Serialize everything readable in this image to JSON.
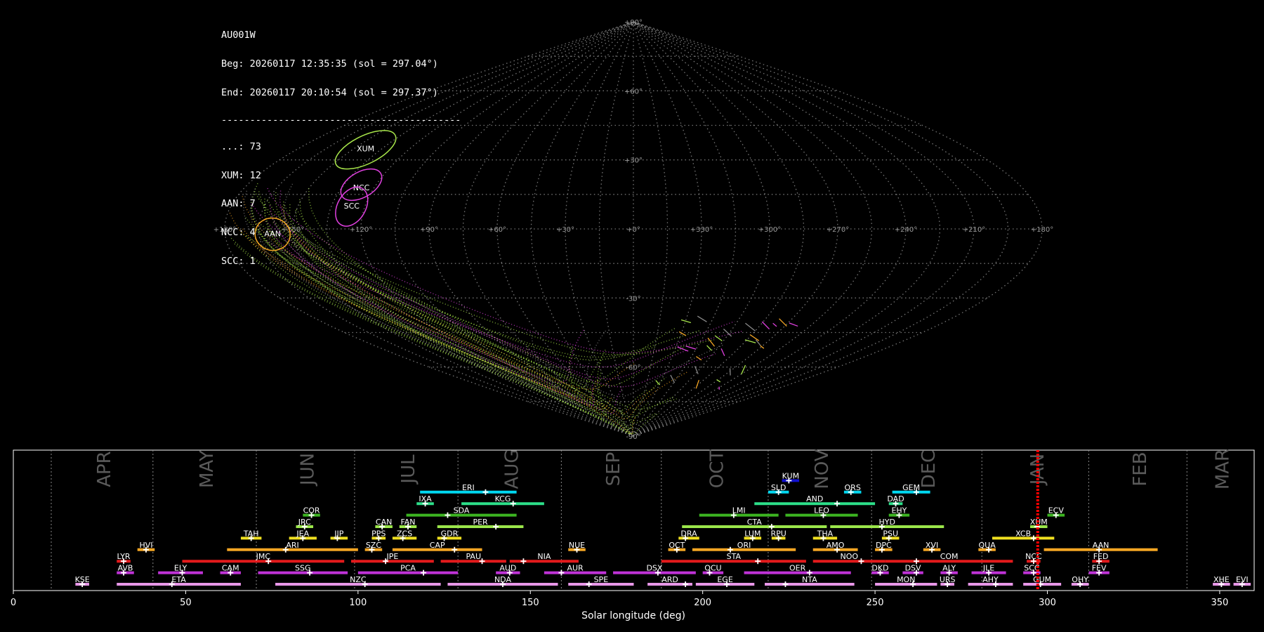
{
  "info": {
    "station": "AU001W",
    "begin": "Beg: 20260117 12:35:35 (sol = 297.04°)",
    "end": "End: 20260117 20:10:54 (sol = 297.37°)",
    "separator": "------------------------------------------",
    "counts": [
      "...: 73",
      "XUM: 12",
      "AAN: 7",
      "NCC: 4",
      "SCC: 1"
    ]
  },
  "colors": {
    "background": "#000000",
    "grid": "#8a8a8a",
    "yellow_green": "#a8e64a",
    "magenta": "#e040e0",
    "orange": "#f5a623",
    "red": "#e31a1c",
    "green": "#3cb521",
    "cyan": "#00d8f0",
    "teal_green": "#2de08a",
    "light_green": "#9be64a",
    "yellow": "#f0e020",
    "purple": "#c033d8",
    "pink": "#e896e8",
    "blue": "#1010d0",
    "sol_marker": "#ff0000"
  },
  "sky_map": {
    "projection": "sinusoidal",
    "lat_labels": [
      "+90°",
      "+60°",
      "+30°",
      "-30°",
      "-60°",
      "-90°"
    ],
    "lon_labels": [
      "+180°",
      "+150°",
      "+120°",
      "+90°",
      "+60°",
      "+30°",
      "+0°",
      "+330°",
      "+300°",
      "+270°",
      "+240°",
      "+210°",
      "+180°"
    ],
    "showers": [
      {
        "code": "XUM",
        "lon": 144,
        "lat": 35,
        "color": "yellow_green"
      },
      {
        "code": "NCC",
        "lon": 126,
        "lat": 18,
        "color": "magenta"
      },
      {
        "code": "SCC",
        "lon": 126,
        "lat": 10,
        "color": "magenta"
      },
      {
        "code": "AAN",
        "lon": 159,
        "lat": -2,
        "color": "orange"
      }
    ]
  },
  "chart_data": {
    "type": "gantt",
    "title": "",
    "xlabel": "Solar longitude (deg)",
    "xlim": [
      0,
      360
    ],
    "xticks": [
      0,
      50,
      100,
      150,
      200,
      250,
      300,
      350
    ],
    "current_sol": [
      297.04,
      297.37
    ],
    "months": [
      {
        "name": "APR",
        "start": 11
      },
      {
        "name": "MAY",
        "start": 40.5
      },
      {
        "name": "JUN",
        "start": 70.5
      },
      {
        "name": "JUL",
        "start": 99
      },
      {
        "name": "AUG",
        "start": 129
      },
      {
        "name": "SEP",
        "start": 159
      },
      {
        "name": "OCT",
        "start": 188
      },
      {
        "name": "NOV",
        "start": 219
      },
      {
        "name": "DEC",
        "start": 249
      },
      {
        "name": "JAN",
        "start": 281
      },
      {
        "name": "FEB",
        "start": 312
      },
      {
        "name": "MAR",
        "start": 340.5
      }
    ],
    "showers": [
      {
        "code": "KUM",
        "start": 223,
        "end": 228,
        "peak": 225,
        "row": 10,
        "color": "blue"
      },
      {
        "code": "ERI",
        "start": 118,
        "end": 146,
        "peak": 137,
        "row": 9,
        "color": "cyan"
      },
      {
        "code": "SLD",
        "start": 219,
        "end": 225,
        "peak": 222,
        "row": 9,
        "color": "cyan"
      },
      {
        "code": "ORS",
        "start": 241,
        "end": 246,
        "peak": 243,
        "row": 9,
        "color": "cyan"
      },
      {
        "code": "GEM",
        "start": 255,
        "end": 266,
        "peak": 262,
        "row": 9,
        "color": "cyan"
      },
      {
        "code": "IXA",
        "start": 117,
        "end": 122,
        "peak": 119.5,
        "row": 8,
        "color": "teal_green"
      },
      {
        "code": "KCG",
        "start": 130,
        "end": 154,
        "peak": 145,
        "row": 8,
        "color": "teal_green"
      },
      {
        "code": "AND",
        "start": 215,
        "end": 250,
        "peak": 239,
        "row": 8,
        "color": "teal_green"
      },
      {
        "code": "DAD",
        "start": 254,
        "end": 258,
        "peak": 256,
        "row": 8,
        "color": "teal_green"
      },
      {
        "code": "COR",
        "start": 84,
        "end": 89,
        "peak": 86.5,
        "row": 7,
        "color": "green"
      },
      {
        "code": "SDA",
        "start": 114,
        "end": 146,
        "peak": 126,
        "row": 7,
        "color": "green"
      },
      {
        "code": "LMI",
        "start": 199,
        "end": 222,
        "peak": 209,
        "row": 7,
        "color": "green"
      },
      {
        "code": "LEO",
        "start": 224,
        "end": 245,
        "peak": 235,
        "row": 7,
        "color": "green"
      },
      {
        "code": "EHY",
        "start": 254,
        "end": 260,
        "peak": 257,
        "row": 7,
        "color": "green"
      },
      {
        "code": "ECV",
        "start": 300,
        "end": 305,
        "peak": 302.5,
        "row": 7,
        "color": "green"
      },
      {
        "code": "JRC",
        "start": 82,
        "end": 87,
        "peak": 84.5,
        "row": 6,
        "color": "light_green"
      },
      {
        "code": "CAN",
        "start": 105,
        "end": 110,
        "peak": 107,
        "row": 6,
        "color": "light_green"
      },
      {
        "code": "FAN",
        "start": 112,
        "end": 117,
        "peak": 114.5,
        "row": 6,
        "color": "light_green"
      },
      {
        "code": "PER",
        "start": 123,
        "end": 148,
        "peak": 140,
        "row": 6,
        "color": "light_green"
      },
      {
        "code": "CTA",
        "start": 194,
        "end": 236,
        "peak": 220,
        "row": 6,
        "color": "light_green"
      },
      {
        "code": "HYD",
        "start": 237,
        "end": 270,
        "peak": 252,
        "row": 6,
        "color": "light_green"
      },
      {
        "code": "XUM",
        "start": 295,
        "end": 300,
        "peak": 297,
        "row": 6,
        "color": "light_green"
      },
      {
        "code": "TAH",
        "start": 66,
        "end": 72,
        "peak": 69,
        "row": 5,
        "color": "yellow"
      },
      {
        "code": "JEA",
        "start": 80,
        "end": 88,
        "peak": 84,
        "row": 5,
        "color": "yellow"
      },
      {
        "code": "JIP",
        "start": 92,
        "end": 97,
        "peak": 94,
        "row": 5,
        "color": "yellow"
      },
      {
        "code": "PPS",
        "start": 104,
        "end": 108,
        "peak": 106,
        "row": 5,
        "color": "yellow"
      },
      {
        "code": "ZCS",
        "start": 110,
        "end": 117,
        "peak": 113,
        "row": 5,
        "color": "yellow"
      },
      {
        "code": "GDR",
        "start": 123,
        "end": 130,
        "peak": 125,
        "row": 5,
        "color": "yellow"
      },
      {
        "code": "DRA",
        "start": 193,
        "end": 199,
        "peak": 195,
        "row": 5,
        "color": "yellow"
      },
      {
        "code": "LUM",
        "start": 212,
        "end": 217,
        "peak": 214.5,
        "row": 5,
        "color": "yellow"
      },
      {
        "code": "RPU",
        "start": 220,
        "end": 224,
        "peak": 222,
        "row": 5,
        "color": "yellow"
      },
      {
        "code": "THA",
        "start": 232,
        "end": 239,
        "peak": 235,
        "row": 5,
        "color": "yellow"
      },
      {
        "code": "PSU",
        "start": 252,
        "end": 257,
        "peak": 254,
        "row": 5,
        "color": "yellow"
      },
      {
        "code": "XCB",
        "start": 284,
        "end": 302,
        "peak": 296,
        "row": 5,
        "color": "yellow"
      },
      {
        "code": "HVI",
        "start": 36,
        "end": 41,
        "peak": 38.5,
        "row": 4,
        "color": "orange"
      },
      {
        "code": "ARI",
        "start": 62,
        "end": 100,
        "peak": 79,
        "row": 4,
        "color": "orange"
      },
      {
        "code": "SZC",
        "start": 102,
        "end": 107,
        "peak": 104,
        "row": 4,
        "color": "orange"
      },
      {
        "code": "CAP",
        "start": 110,
        "end": 136,
        "peak": 128,
        "row": 4,
        "color": "orange"
      },
      {
        "code": "NUE",
        "start": 161,
        "end": 166,
        "peak": 163.5,
        "row": 4,
        "color": "orange"
      },
      {
        "code": "OCT",
        "start": 190,
        "end": 195,
        "peak": 192.5,
        "row": 4,
        "color": "orange"
      },
      {
        "code": "ORI",
        "start": 197,
        "end": 227,
        "peak": 208,
        "row": 4,
        "color": "orange"
      },
      {
        "code": "AMO",
        "start": 232,
        "end": 245,
        "peak": 239,
        "row": 4,
        "color": "orange"
      },
      {
        "code": "DPC",
        "start": 250,
        "end": 255,
        "peak": 252,
        "row": 4,
        "color": "orange"
      },
      {
        "code": "XVI",
        "start": 264,
        "end": 269,
        "peak": 266.5,
        "row": 4,
        "color": "orange"
      },
      {
        "code": "QUA",
        "start": 280,
        "end": 285,
        "peak": 283,
        "row": 4,
        "color": "orange"
      },
      {
        "code": "AAN",
        "start": 299,
        "end": 332,
        "peak": 315,
        "row": 4,
        "color": "orange"
      },
      {
        "code": "LYR",
        "start": 30,
        "end": 34,
        "peak": 32,
        "row": 3,
        "color": "red"
      },
      {
        "code": "JMC",
        "start": 49,
        "end": 96,
        "peak": 74,
        "row": 3,
        "color": "red"
      },
      {
        "code": "JPE",
        "start": 98,
        "end": 122,
        "peak": 108,
        "row": 3,
        "color": "red"
      },
      {
        "code": "PAU",
        "start": 124,
        "end": 143,
        "peak": 136,
        "row": 3,
        "color": "red"
      },
      {
        "code": "NIA",
        "start": 144,
        "end": 164,
        "peak": 148,
        "row": 3,
        "color": "red"
      },
      {
        "code": "STA",
        "start": 188,
        "end": 230,
        "peak": 216,
        "row": 3,
        "color": "red"
      },
      {
        "code": "NOO",
        "start": 232,
        "end": 253,
        "peak": 246,
        "row": 3,
        "color": "red"
      },
      {
        "code": "COM",
        "start": 253,
        "end": 290,
        "peak": 262,
        "row": 3,
        "color": "red"
      },
      {
        "code": "NCC",
        "start": 294,
        "end": 298,
        "peak": 296,
        "row": 3,
        "color": "red"
      },
      {
        "code": "FED",
        "start": 313,
        "end": 318,
        "peak": 315,
        "row": 3,
        "color": "red"
      },
      {
        "code": "AVB",
        "start": 30,
        "end": 35,
        "peak": 32,
        "row": 2,
        "color": "purple"
      },
      {
        "code": "ELY",
        "start": 42,
        "end": 55,
        "peak": 49,
        "row": 2,
        "color": "purple"
      },
      {
        "code": "CAM",
        "start": 60,
        "end": 66,
        "peak": 63,
        "row": 2,
        "color": "purple"
      },
      {
        "code": "SSG",
        "start": 71,
        "end": 97,
        "peak": 86,
        "row": 2,
        "color": "purple"
      },
      {
        "code": "PCA",
        "start": 100,
        "end": 129,
        "peak": 119,
        "row": 2,
        "color": "purple"
      },
      {
        "code": "AUD",
        "start": 140,
        "end": 147,
        "peak": 144,
        "row": 2,
        "color": "purple"
      },
      {
        "code": "AUR",
        "start": 154,
        "end": 172,
        "peak": 159,
        "row": 2,
        "color": "purple"
      },
      {
        "code": "DSX",
        "start": 174,
        "end": 198,
        "peak": 187,
        "row": 2,
        "color": "purple"
      },
      {
        "code": "OCU",
        "start": 200,
        "end": 206,
        "peak": 202,
        "row": 2,
        "color": "purple"
      },
      {
        "code": "OER",
        "start": 212,
        "end": 243,
        "peak": 231,
        "row": 2,
        "color": "purple"
      },
      {
        "code": "DKD",
        "start": 249,
        "end": 254,
        "peak": 251.5,
        "row": 2,
        "color": "purple"
      },
      {
        "code": "DSV",
        "start": 258,
        "end": 264,
        "peak": 262,
        "row": 2,
        "color": "purple"
      },
      {
        "code": "ALY",
        "start": 269,
        "end": 274,
        "peak": 271.5,
        "row": 2,
        "color": "purple"
      },
      {
        "code": "JLE",
        "start": 278,
        "end": 288,
        "peak": 283,
        "row": 2,
        "color": "purple"
      },
      {
        "code": "SCC",
        "start": 293,
        "end": 298,
        "peak": 296,
        "row": 2,
        "color": "purple"
      },
      {
        "code": "FEV",
        "start": 312,
        "end": 318,
        "peak": 315,
        "row": 2,
        "color": "purple"
      },
      {
        "code": "KSE",
        "start": 18,
        "end": 22,
        "peak": 20,
        "row": 1,
        "color": "pink"
      },
      {
        "code": "ETA",
        "start": 30,
        "end": 66,
        "peak": 46,
        "row": 1,
        "color": "pink"
      },
      {
        "code": "NZC",
        "start": 76,
        "end": 124,
        "peak": 102,
        "row": 1,
        "color": "pink"
      },
      {
        "code": "NDA",
        "start": 126,
        "end": 158,
        "peak": 142,
        "row": 1,
        "color": "pink"
      },
      {
        "code": "SPE",
        "start": 161,
        "end": 180,
        "peak": 167,
        "row": 1,
        "color": "pink"
      },
      {
        "code": "ARD",
        "start": 184,
        "end": 197,
        "peak": 195,
        "row": 1,
        "color": "pink"
      },
      {
        "code": "EGE",
        "start": 198,
        "end": 215,
        "peak": 207,
        "row": 1,
        "color": "pink"
      },
      {
        "code": "NTA",
        "start": 218,
        "end": 244,
        "peak": 224,
        "row": 1,
        "color": "pink"
      },
      {
        "code": "MON",
        "start": 250,
        "end": 268,
        "peak": 261,
        "row": 1,
        "color": "pink"
      },
      {
        "code": "URS",
        "start": 269,
        "end": 273,
        "peak": 271,
        "row": 1,
        "color": "pink"
      },
      {
        "code": "AHY",
        "start": 277,
        "end": 290,
        "peak": 285,
        "row": 1,
        "color": "pink"
      },
      {
        "code": "GUM",
        "start": 293,
        "end": 304,
        "peak": 298,
        "row": 1,
        "color": "pink"
      },
      {
        "code": "OHY",
        "start": 307,
        "end": 312,
        "peak": 309.5,
        "row": 1,
        "color": "pink"
      },
      {
        "code": "XHE",
        "start": 348,
        "end": 353,
        "peak": 350.5,
        "row": 1,
        "color": "pink"
      },
      {
        "code": "EVI",
        "start": 354,
        "end": 359,
        "peak": 356.5,
        "row": 1,
        "color": "pink"
      }
    ]
  }
}
